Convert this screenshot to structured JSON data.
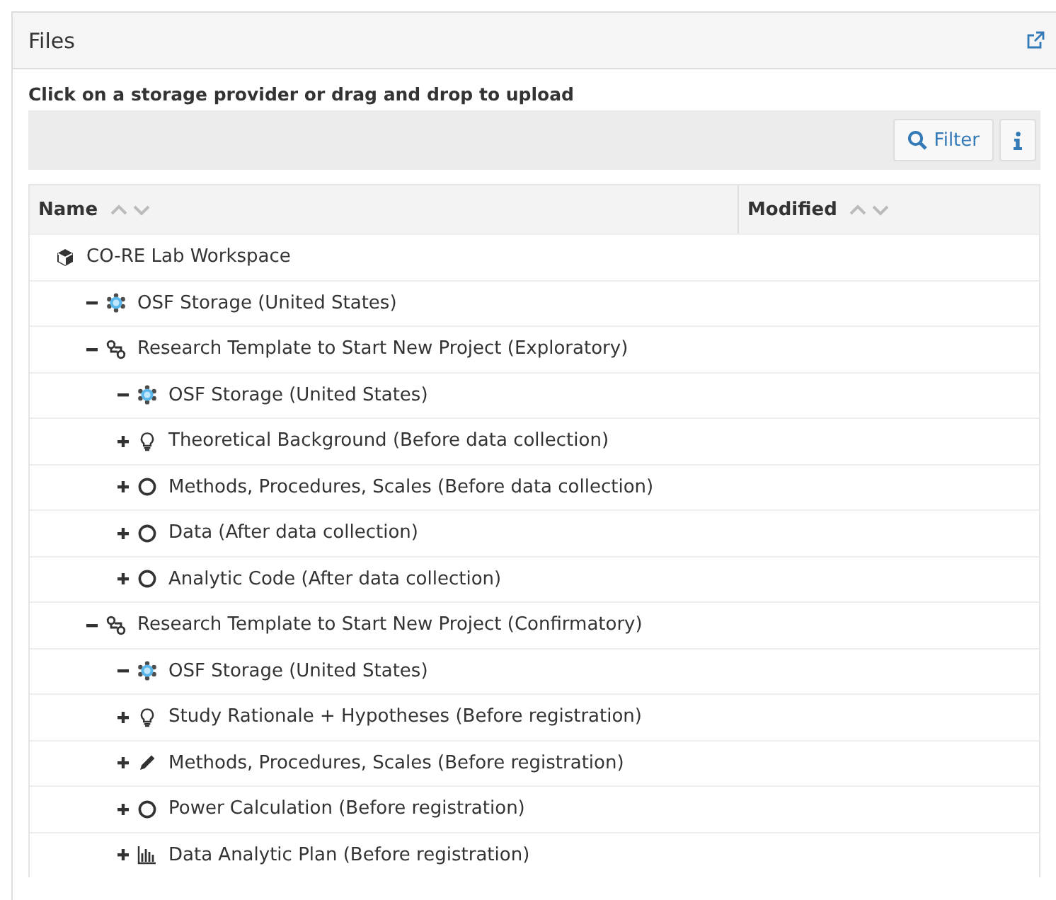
{
  "panel": {
    "title": "Files"
  },
  "instruction": "Click on a storage provider or drag and drop to upload",
  "toolbar": {
    "filter_label": "Filter"
  },
  "table": {
    "columns": [
      {
        "label": "Name"
      },
      {
        "label": "Modified"
      }
    ],
    "tree": [
      {
        "label": "CO-RE Lab Workspace",
        "kind": "project",
        "children": [
          {
            "label": "OSF Storage (United States)",
            "kind": "storage",
            "expanded": true
          },
          {
            "label": "Research Template to Start New Project (Exploratory)",
            "kind": "link",
            "expanded": true,
            "children": [
              {
                "label": "OSF Storage (United States)",
                "kind": "storage",
                "expanded": true
              },
              {
                "label": "Theoretical Background (Before data collection)",
                "kind": "bulb",
                "expanded": false
              },
              {
                "label": "Methods, Procedures, Scales (Before data collection)",
                "kind": "circle",
                "expanded": false
              },
              {
                "label": "Data (After data collection)",
                "kind": "circle",
                "expanded": false
              },
              {
                "label": "Analytic Code (After data collection)",
                "kind": "circle",
                "expanded": false
              }
            ]
          },
          {
            "label": "Research Template to Start New Project (Confirmatory)",
            "kind": "link",
            "expanded": true,
            "children": [
              {
                "label": "OSF Storage (United States)",
                "kind": "storage",
                "expanded": true
              },
              {
                "label": "Study Rationale + Hypotheses (Before registration)",
                "kind": "bulb",
                "expanded": false
              },
              {
                "label": "Methods, Procedures, Scales (Before registration)",
                "kind": "pencil",
                "expanded": false
              },
              {
                "label": "Power Calculation (Before registration)",
                "kind": "circle",
                "expanded": false
              },
              {
                "label": "Data Analytic Plan (Before registration)",
                "kind": "chart",
                "expanded": false
              }
            ]
          }
        ]
      }
    ]
  }
}
